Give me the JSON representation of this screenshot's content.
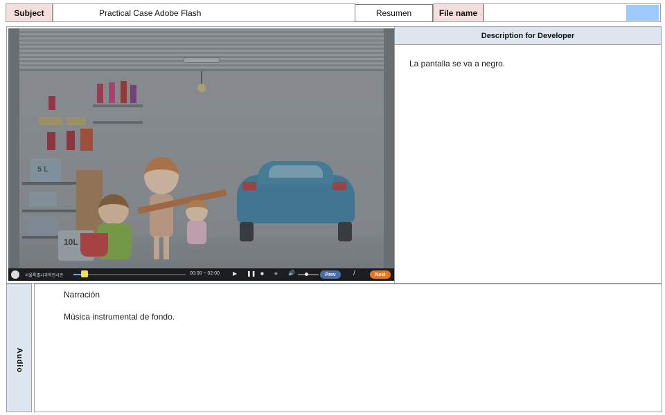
{
  "header": {
    "subject_label": "Subject",
    "subject_value": "Practical Case Adobe Flash",
    "summary_label": "Resumen",
    "file_name_label": "File name",
    "file_name_value": "",
    "accent": "#9ecbfb"
  },
  "video": {
    "scene_labels": {
      "can_small": "5 L",
      "can_large": "10L"
    },
    "player": {
      "logo_text": "서울특별시과학전시관",
      "time": "00:00 ~ 02:00",
      "separator": "/",
      "prev_label": "Prev",
      "next_label": "Next",
      "progress": 0.1,
      "volume": 0.4
    }
  },
  "developer": {
    "title": "Description for Developer",
    "text": "La pantalla se va a negro."
  },
  "audio": {
    "side_label": "Audio",
    "narration_label": "Narración",
    "music_text": "Música instrumental de fondo."
  },
  "colors": {
    "label_bg": "#f4dede",
    "panel_header_bg": "#dde6ef",
    "next_button": "#e8761e",
    "prev_button": "#4a6ea8"
  }
}
